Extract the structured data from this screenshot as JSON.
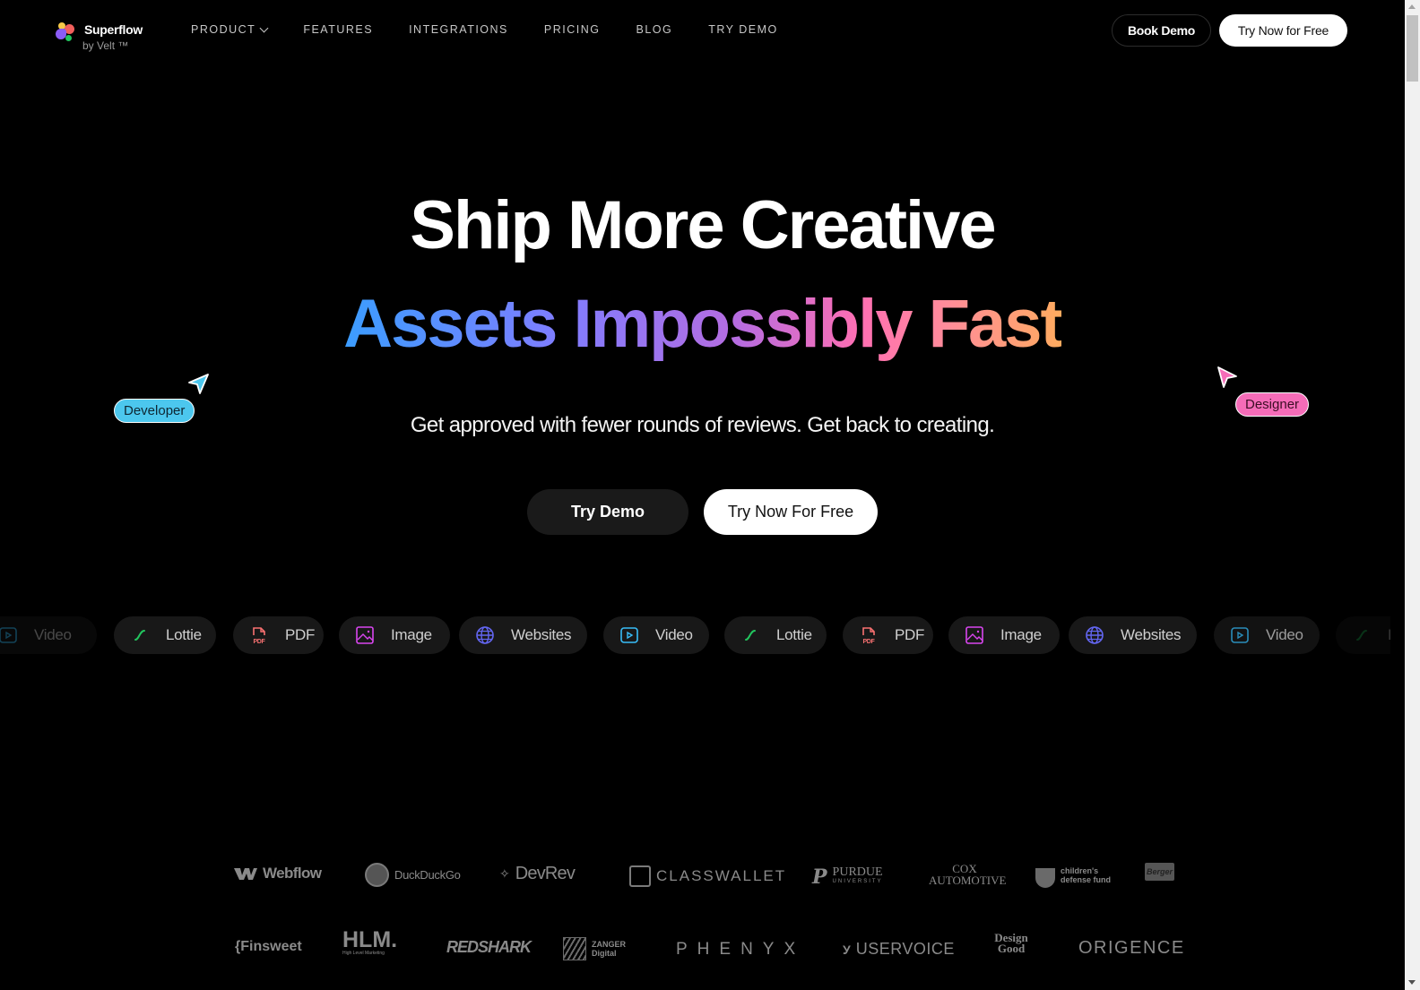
{
  "nav": {
    "brand_name": "Superflow",
    "brand_sub": "by Velt ™",
    "links": [
      "PRODUCT",
      "FEATURES",
      "INTEGRATIONS",
      "PRICING",
      "BLOG",
      "TRY DEMO"
    ],
    "book_demo": "Book Demo",
    "try_now": "Try Now for Free"
  },
  "hero": {
    "line1": "Ship More Creative",
    "line2": "Assets Impossibly Fast",
    "subtitle": "Get approved with fewer rounds of reviews. Get back to creating.",
    "btn_demo": "Try Demo",
    "btn_free": "Try Now For Free",
    "tag_developer": "Developer",
    "tag_designer": "Designer",
    "gradient_colors": [
      "#3b9dff",
      "#7f7dff",
      "#b66ce0",
      "#ff6fb2",
      "#ffab5f"
    ]
  },
  "assets": [
    {
      "label": "Video",
      "icon": "video-icon",
      "color": "#38bdf8"
    },
    {
      "label": "Lottie",
      "icon": "lottie-icon",
      "color": "#22c55e"
    },
    {
      "label": "PDF",
      "icon": "pdf-icon",
      "color": "#f87171"
    },
    {
      "label": "Image",
      "icon": "image-icon",
      "color": "#d946ef"
    },
    {
      "label": "Websites",
      "icon": "globe-icon",
      "color": "#6366f1"
    },
    {
      "label": "Video",
      "icon": "video-icon",
      "color": "#38bdf8"
    },
    {
      "label": "Lottie",
      "icon": "lottie-icon",
      "color": "#22c55e"
    },
    {
      "label": "PDF",
      "icon": "pdf-icon",
      "color": "#f87171"
    },
    {
      "label": "Image",
      "icon": "image-icon",
      "color": "#d946ef"
    },
    {
      "label": "Websites",
      "icon": "globe-icon",
      "color": "#6366f1"
    },
    {
      "label": "Video",
      "icon": "video-icon",
      "color": "#38bdf8"
    },
    {
      "label": "Lottie",
      "icon": "lottie-icon",
      "color": "#22c55e"
    }
  ],
  "logos_row1": [
    "Webflow",
    "DuckDuckGo",
    "DevRev",
    "CLASSWALLET",
    "PURDUE",
    "COX AUTOMOTIVE",
    "children's defense fund",
    "Berger"
  ],
  "logos_row2": [
    "{Finsweet",
    "HLM.",
    "REDSHARK",
    "ZANGER Digital",
    "PHENYX",
    "USERVOICE",
    "Design Good",
    "ORIGENCE"
  ],
  "logo_subs": {
    "purdue": "UNIVERSITY",
    "hlm": "High Level Marketing"
  }
}
